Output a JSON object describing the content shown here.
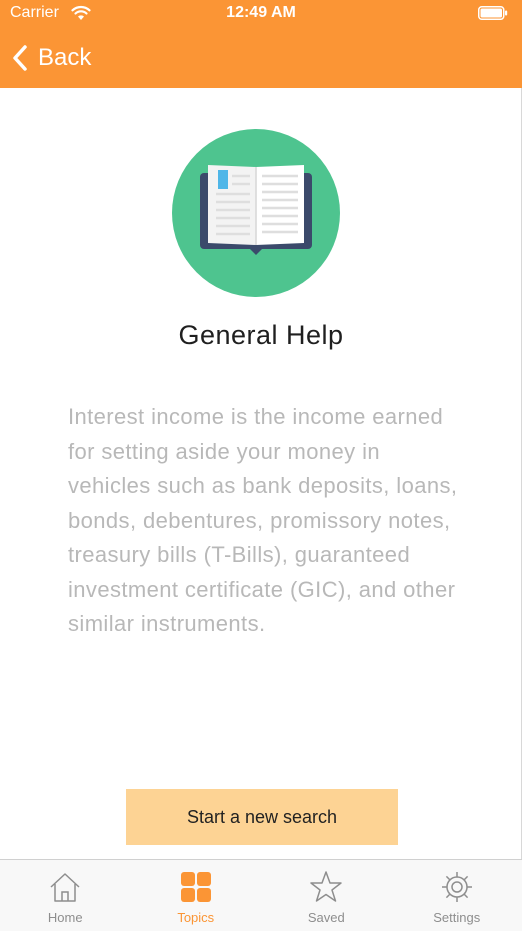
{
  "status_bar": {
    "carrier": "Carrier",
    "time": "12:49 AM"
  },
  "nav": {
    "back_label": "Back"
  },
  "content": {
    "title": "General Help",
    "description": "Interest income is the income earned for setting aside your money in vehicles such as bank deposits, loans, bonds, debentures, promissory notes, treasury bills (T-Bills), guaranteed investment certificate (GIC), and other similar instruments.",
    "cta_label": "Start a new search"
  },
  "tabs": [
    {
      "label": "Home",
      "icon": "home-icon",
      "active": false
    },
    {
      "label": "Topics",
      "icon": "grid-icon",
      "active": true
    },
    {
      "label": "Saved",
      "icon": "star-icon",
      "active": false
    },
    {
      "label": "Settings",
      "icon": "gear-icon",
      "active": false
    }
  ],
  "colors": {
    "accent": "#fb9535",
    "cta_background": "#fdd394",
    "hero_circle": "#4ec48f",
    "book_cover": "#3b4a6b",
    "bookmark": "#4fb6e8"
  }
}
